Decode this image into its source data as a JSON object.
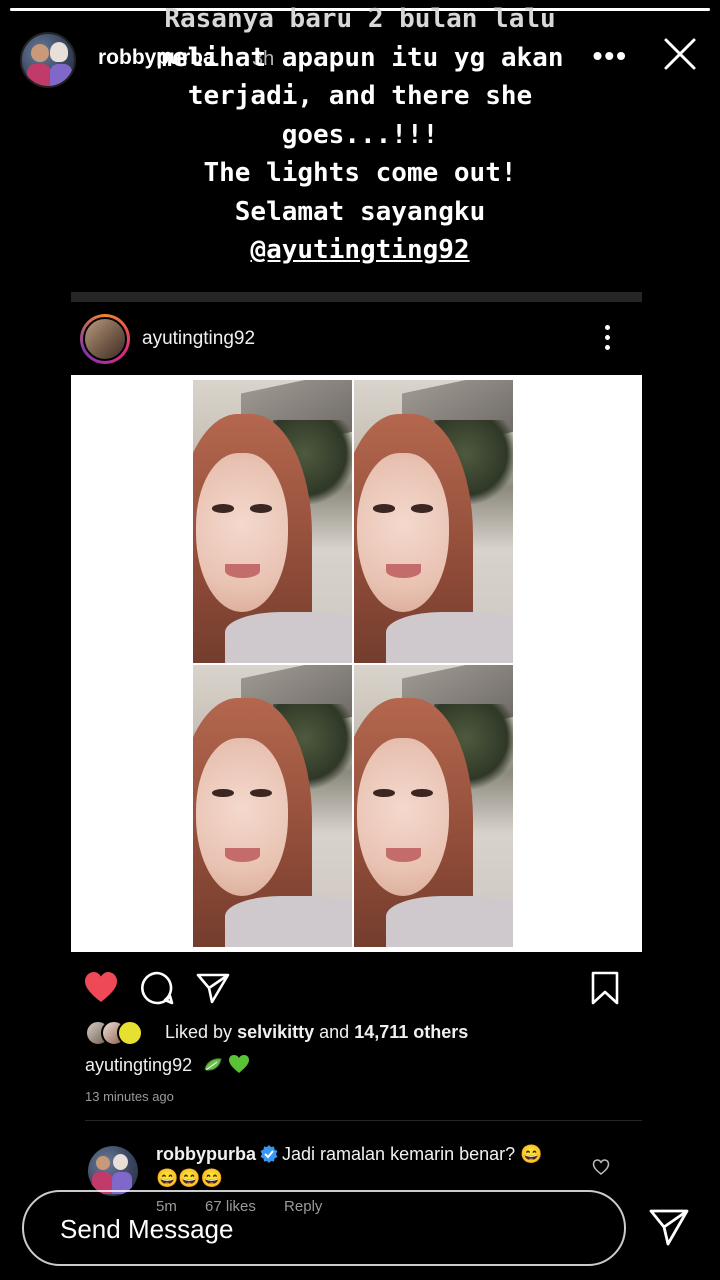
{
  "story": {
    "progress_fraction": 1.0,
    "username": "robbypurba",
    "time": "3h",
    "caption_lines": [
      "Rasanya baru 2 bulan lalu",
      "melihat apapun itu yg akan",
      "terjadi, and there she",
      "goes...!!!",
      "The lights come out!",
      "Selamat sayangku"
    ],
    "caption_mention": "@ayutingting92"
  },
  "post": {
    "username": "ayutingting92",
    "likes_prefix": "Liked by",
    "likes_user": "selvikitty",
    "likes_middle": "and",
    "likes_count": "14,711 others",
    "caption_user": "ayutingting92",
    "time_ago": "13 minutes ago",
    "liked": true,
    "colors": {
      "heart": "#ed4956",
      "verified": "#3897f0",
      "leaf": "#6bc04b"
    }
  },
  "comment": {
    "username": "robbypurba",
    "text_line1": "Jadi ramalan kemarin benar? 😄",
    "text_line2": "😄😄😄",
    "age": "5m",
    "likes": "67 likes",
    "reply": "Reply"
  },
  "composer": {
    "placeholder": "Send Message"
  }
}
